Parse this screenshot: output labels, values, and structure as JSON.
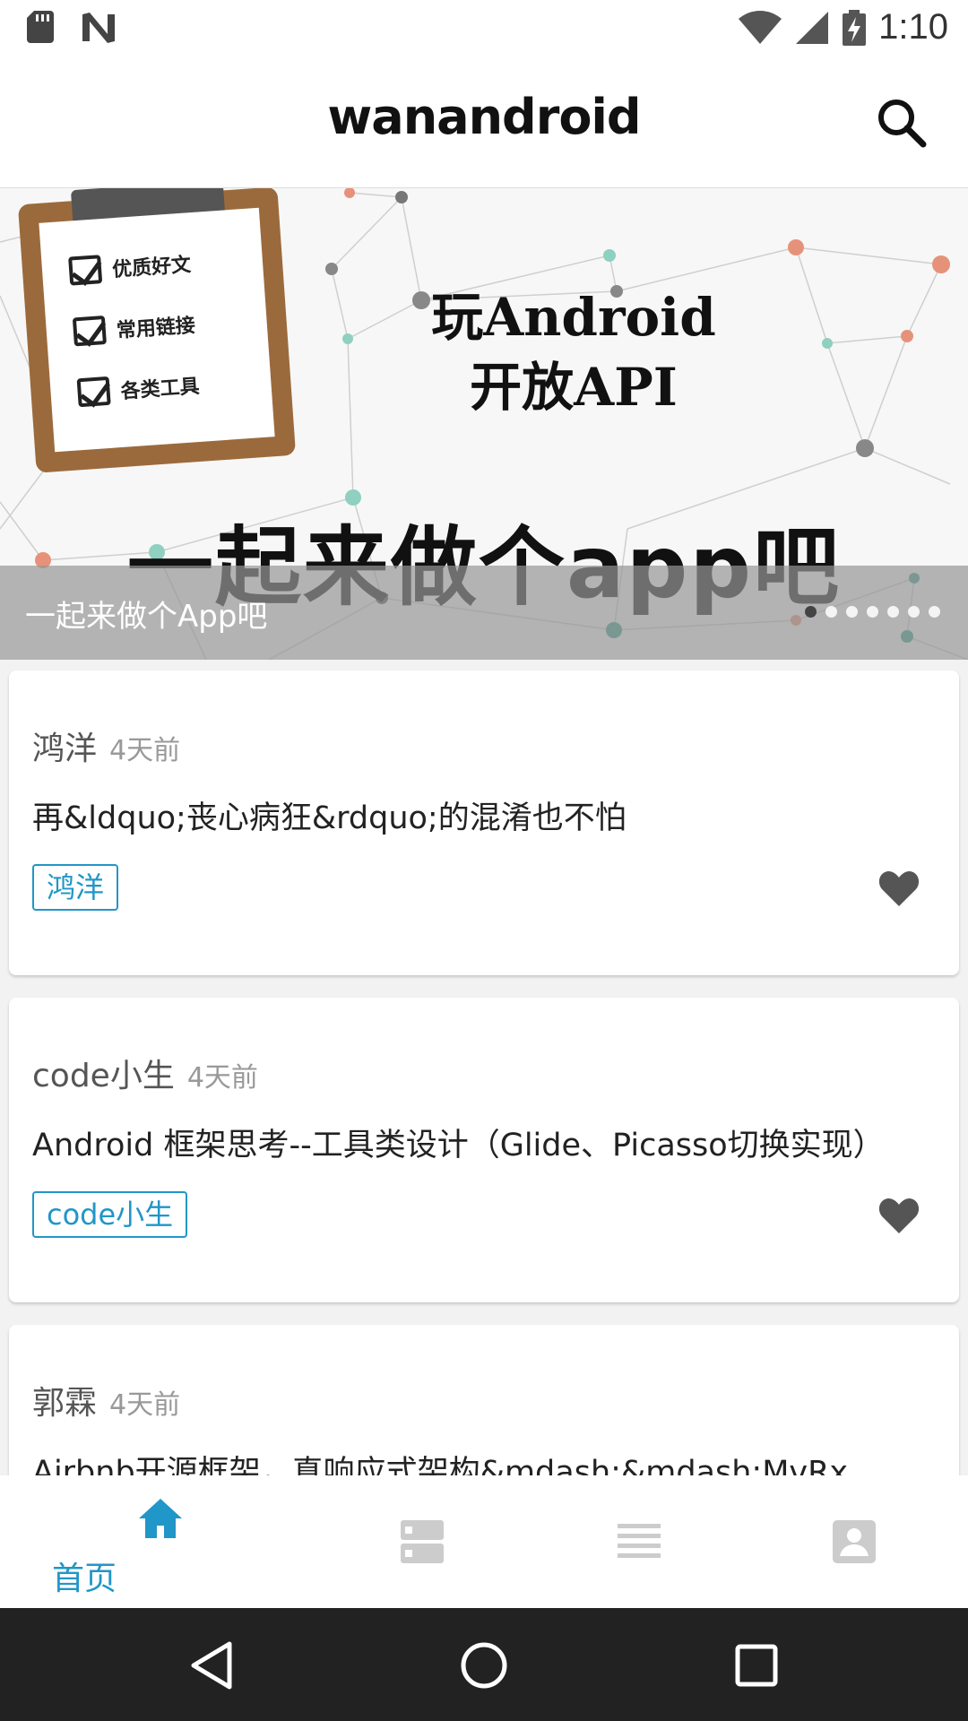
{
  "status_bar": {
    "time": "1:10",
    "icons": [
      "sd-card-icon",
      "n-logo-icon",
      "wifi-icon",
      "cell-signal-icon",
      "battery-charging-icon"
    ]
  },
  "app_bar": {
    "title": "wanandroid",
    "search_icon": "search-icon"
  },
  "banner": {
    "checklist": [
      "优质好文",
      "常用链接",
      "各类工具"
    ],
    "headline_line1": "玩Android",
    "headline_line2": "开放API",
    "big_text": "一起来做个app吧",
    "caption": "一起来做个App吧",
    "page_count": 7,
    "active_page": 1
  },
  "articles": [
    {
      "author": "鸿洋",
      "time": "4天前",
      "title": "再&ldquo;丧心病狂&rdquo;的混淆也不怕",
      "tag": "鸿洋"
    },
    {
      "author": "code小生",
      "time": "4天前",
      "title": "Android 框架思考--工具类设计（Glide、Picasso切换实现）",
      "tag": "code小生"
    },
    {
      "author": "郭霖",
      "time": "4天前",
      "title": "Airbnb开源框架，真响应式架构&mdash;&mdash;MvRx",
      "tag": ""
    }
  ],
  "bottom_nav": {
    "items": [
      {
        "label": "首页",
        "icon": "home-icon",
        "active": true
      },
      {
        "label": "",
        "icon": "knowledge-icon",
        "active": false
      },
      {
        "label": "",
        "icon": "list-icon",
        "active": false
      },
      {
        "label": "",
        "icon": "profile-icon",
        "active": false
      }
    ]
  },
  "colors": {
    "accent": "#2196c8",
    "inactive_icon": "#cccccc",
    "heart": "#555555"
  }
}
